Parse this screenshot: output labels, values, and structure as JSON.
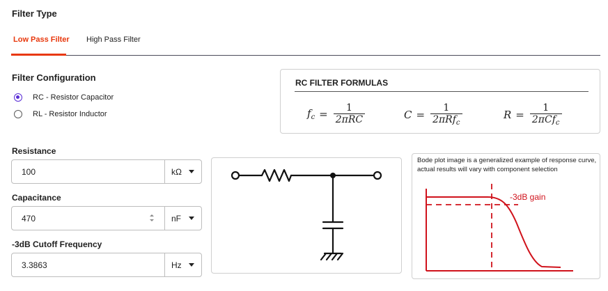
{
  "filter_type": {
    "heading": "Filter Type",
    "tabs": [
      {
        "label": "Low Pass Filter",
        "active": true
      },
      {
        "label": "High Pass Filter",
        "active": false
      }
    ]
  },
  "configuration": {
    "heading": "Filter Configuration",
    "options": [
      {
        "label": "RC - Resistor Capacitor",
        "selected": true
      },
      {
        "label": "RL - Resistor Inductor",
        "selected": false
      }
    ]
  },
  "formulas": {
    "title": "RC FILTER FORMULAS",
    "fc": {
      "lhs": "f",
      "lhs_sub": "c",
      "num": "1",
      "den": "2πRC"
    },
    "c": {
      "lhs": "C",
      "num": "1",
      "den": "2πRf",
      "den_sub": "c"
    },
    "r": {
      "lhs": "R",
      "num": "1",
      "den": "2πCf",
      "den_sub": "c"
    }
  },
  "fields": {
    "resistance": {
      "label": "Resistance",
      "value": "100",
      "unit": "kΩ"
    },
    "capacitance": {
      "label": "Capacitance",
      "value": "470",
      "unit": "nF"
    },
    "cutoff": {
      "label": "-3dB Cutoff Frequency",
      "value": "3.3863",
      "unit": "Hz"
    }
  },
  "bode": {
    "note": "Bode plot image is a generalized example of response curve, actual results will vary with component selection",
    "gain_label": "-3dB gain"
  },
  "colors": {
    "accent": "#e8380d",
    "radio": "#5a2ed6",
    "bode_red": "#d0121b"
  }
}
